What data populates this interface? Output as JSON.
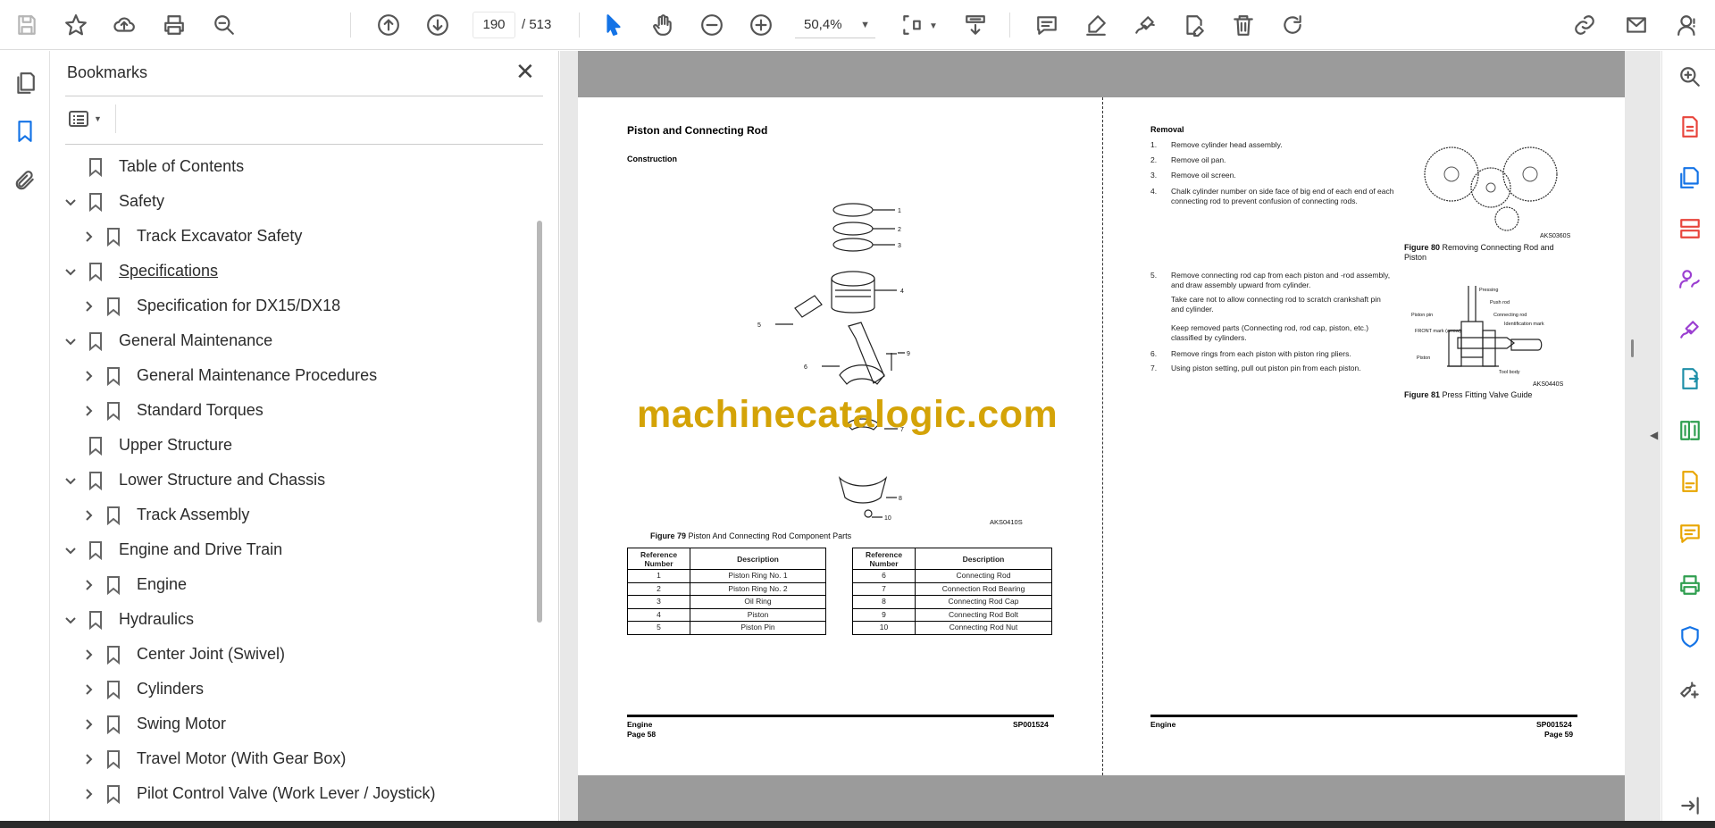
{
  "toolbar": {
    "page_current": "190",
    "page_total": "/  513",
    "zoom": "50,4%",
    "icons": [
      "save-icon",
      "star-icon",
      "upload-icon",
      "print-icon",
      "zoom-search-icon",
      "page-up-icon",
      "page-down-icon",
      "select-cursor-icon",
      "hand-icon",
      "zoom-out-icon",
      "zoom-in-icon",
      "fit-page-icon",
      "scroll-mode-icon",
      "comment-icon",
      "highlight-icon",
      "sign-icon",
      "edit-icon",
      "delete-icon",
      "rotate-icon",
      "link-icon",
      "mail-icon",
      "account-icon"
    ]
  },
  "panel": {
    "title": "Bookmarks",
    "close": "✕",
    "bookmarks": [
      {
        "label": "Table of Contents",
        "level": 0,
        "expander": "none"
      },
      {
        "label": "Safety",
        "level": 0,
        "expander": "open"
      },
      {
        "label": "Track Excavator Safety",
        "level": 1,
        "expander": "closed"
      },
      {
        "label": "Specifications",
        "level": 0,
        "expander": "open",
        "underline": true
      },
      {
        "label": "Specification for DX15/DX18",
        "level": 1,
        "expander": "closed"
      },
      {
        "label": "General Maintenance",
        "level": 0,
        "expander": "open"
      },
      {
        "label": "General Maintenance Procedures",
        "level": 1,
        "expander": "closed"
      },
      {
        "label": "Standard Torques",
        "level": 1,
        "expander": "closed"
      },
      {
        "label": "Upper Structure",
        "level": 0,
        "expander": "none"
      },
      {
        "label": "Lower Structure and Chassis",
        "level": 0,
        "expander": "open"
      },
      {
        "label": "Track Assembly",
        "level": 1,
        "expander": "closed"
      },
      {
        "label": "Engine and Drive Train",
        "level": 0,
        "expander": "open"
      },
      {
        "label": "Engine",
        "level": 1,
        "expander": "closed"
      },
      {
        "label": "Hydraulics",
        "level": 0,
        "expander": "open"
      },
      {
        "label": "Center Joint (Swivel)",
        "level": 1,
        "expander": "closed"
      },
      {
        "label": "Cylinders",
        "level": 1,
        "expander": "closed"
      },
      {
        "label": "Swing Motor",
        "level": 1,
        "expander": "closed"
      },
      {
        "label": "Travel Motor (With Gear Box)",
        "level": 1,
        "expander": "closed"
      },
      {
        "label": "Pilot Control Valve (Work Lever / Joystick)",
        "level": 1,
        "expander": "closed"
      }
    ]
  },
  "doc": {
    "left": {
      "title": "Piston and Connecting Rod",
      "subtitle": "Construction",
      "figure_code": "AKS0410S",
      "figure_caption_num": "Figure 79",
      "figure_caption_text": "Piston And Connecting Rod Component Parts",
      "callouts": [
        "1",
        "2",
        "3",
        "4",
        "5",
        "6",
        "9",
        "7",
        "8",
        "10"
      ],
      "table_headers": [
        "Reference Number",
        "Description"
      ],
      "table_left": [
        [
          "1",
          "Piston Ring No. 1"
        ],
        [
          "2",
          "Piston Ring No. 2"
        ],
        [
          "3",
          "Oil Ring"
        ],
        [
          "4",
          "Piston"
        ],
        [
          "5",
          "Piston Pin"
        ]
      ],
      "table_right": [
        [
          "6",
          "Connecting Rod"
        ],
        [
          "7",
          "Connection Rod Bearing"
        ],
        [
          "8",
          "Connecting Rod Cap"
        ],
        [
          "9",
          "Connecting Rod Bolt"
        ],
        [
          "10",
          "Connecting Rod Nut"
        ]
      ],
      "footer_section": "Engine",
      "footer_page": "Page 58",
      "footer_code": "SP001524"
    },
    "right": {
      "heading": "Removal",
      "steps": [
        {
          "num": "1.",
          "text": "Remove cylinder head assembly."
        },
        {
          "num": "2.",
          "text": "Remove oil pan."
        },
        {
          "num": "3.",
          "text": "Remove oil screen."
        },
        {
          "num": "4.",
          "text": "Chalk cylinder number on side face of big end of each end of each connecting rod to prevent confusion of connecting rods."
        },
        {
          "num": "5.",
          "text": "Remove connecting rod cap from each piston and -rod assembly, and draw assembly upward from cylinder."
        },
        {
          "num": "",
          "text": "Take care not to allow connecting rod to scratch crankshaft pin and cylinder."
        },
        {
          "num": "",
          "text": "Keep removed parts (Connecting rod, rod cap, piston, etc.) classified by cylinders."
        },
        {
          "num": "6.",
          "text": "Remove rings from each piston with piston ring pliers."
        },
        {
          "num": "7.",
          "text": "Using piston setting, pull out piston pin from each piston."
        }
      ],
      "fig80_code": "AKS0360S",
      "fig80_num": "Figure 80",
      "fig80_text": "Removing Connecting Rod and Piston",
      "fig81_code": "AKS0440S",
      "fig81_num": "Figure 81",
      "fig81_text": "Press Fitting Valve Guide",
      "fig81_labels": [
        "Pressing",
        "Push rod",
        "Connecting rod",
        "Identification mark",
        "Piston pin",
        "FRONT mark (arrow)",
        "Piston",
        "Tool body"
      ],
      "footer_section": "Engine",
      "footer_page": "Page 59",
      "footer_code": "SP001524"
    },
    "watermark": "machinecatalogic.com"
  },
  "right_rail": {
    "icons": [
      {
        "name": "zoom-search-icon",
        "color": "#555555"
      },
      {
        "name": "export-pdf-icon",
        "color": "#e8453c"
      },
      {
        "name": "create-pdf-icon",
        "color": "#1473e6"
      },
      {
        "name": "organize-pages-icon",
        "color": "#e8453c"
      },
      {
        "name": "request-signature-icon",
        "color": "#9b3fd1"
      },
      {
        "name": "fill-sign-icon",
        "color": "#9b3fd1"
      },
      {
        "name": "export-icon",
        "color": "#1e8fa8"
      },
      {
        "name": "compare-icon",
        "color": "#2e9e4f"
      },
      {
        "name": "scan-icon",
        "color": "#e8a500"
      },
      {
        "name": "comment-icon",
        "color": "#e8a500"
      },
      {
        "name": "print-production-icon",
        "color": "#2e9e4f"
      },
      {
        "name": "protect-icon",
        "color": "#1473e6"
      },
      {
        "name": "more-tools-icon",
        "color": "#555555"
      },
      {
        "name": "collapse-rail-icon",
        "color": "#555555"
      }
    ]
  }
}
